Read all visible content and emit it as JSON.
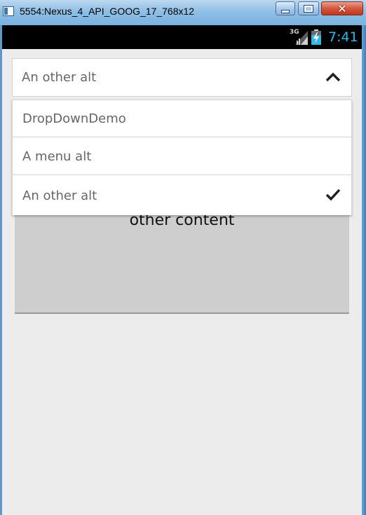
{
  "window": {
    "title": "5554:Nexus_4_API_GOOG_17_768x12",
    "close_glyph": "✕"
  },
  "status_bar": {
    "network": "3G",
    "time": "7:41",
    "clock_color": "#33b5e5"
  },
  "spinner": {
    "selected": "An other alt",
    "expanded": true,
    "icon": "chevron-up-icon"
  },
  "dropdown": {
    "items": [
      {
        "label": "DropDownDemo",
        "checked": false
      },
      {
        "label": "A menu alt",
        "checked": false
      },
      {
        "label": "An other alt",
        "checked": true
      }
    ],
    "check_icon": "checkmark-icon"
  },
  "content": {
    "text": "other content"
  },
  "colors": {
    "screen_bg": "#ececec",
    "panel_bg": "#cecece",
    "text": "#666666"
  }
}
